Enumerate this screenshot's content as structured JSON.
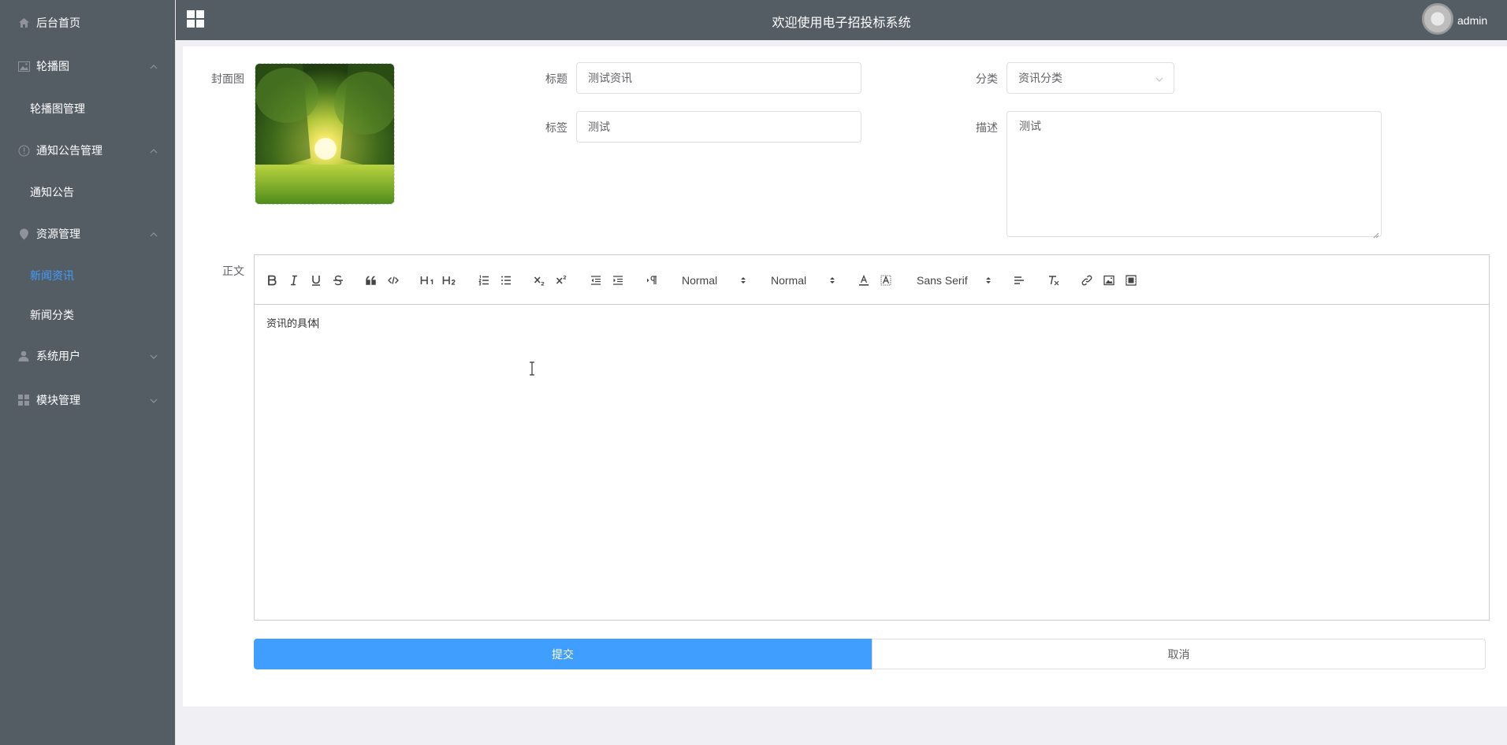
{
  "header": {
    "title": "欢迎使用电子招投标系统",
    "username": "admin"
  },
  "sidebar": {
    "items": [
      {
        "label": "后台首页",
        "icon": "home-icon"
      },
      {
        "label": "轮播图",
        "icon": "image-icon",
        "expanded": true,
        "children": [
          "轮播图管理"
        ]
      },
      {
        "label": "通知公告管理",
        "icon": "info-icon",
        "expanded": true,
        "children": [
          "通知公告"
        ]
      },
      {
        "label": "资源管理",
        "icon": "location-icon",
        "expanded": true,
        "children": [
          "新闻资讯",
          "新闻分类"
        ]
      },
      {
        "label": "系统用户",
        "icon": "user-icon",
        "expanded": false
      },
      {
        "label": "模块管理",
        "icon": "grid-icon",
        "expanded": false
      }
    ],
    "active_child": "新闻资讯"
  },
  "form": {
    "cover_label": "封面图",
    "title_label": "标题",
    "title_value": "测试资讯",
    "category_label": "分类",
    "category_value": "资讯分类",
    "tags_label": "标签",
    "tags_value": "测试",
    "description_label": "描述",
    "description_value": "测试",
    "body_label": "正文",
    "body_value": "资讯的具体"
  },
  "editor_toolbar": {
    "header_select": "Normal",
    "size_select": "Normal",
    "font_select": "Sans Serif",
    "buttons": [
      "bold-icon",
      "italic-icon",
      "underline-icon",
      "strike-icon",
      "blockquote-icon",
      "code-block-icon",
      "h1-icon",
      "h2-icon",
      "ordered-list-icon",
      "bullet-list-icon",
      "subscript-icon",
      "superscript-icon",
      "outdent-icon",
      "indent-icon",
      "rtl-icon",
      "text-color-icon",
      "background-color-icon",
      "align-icon",
      "clear-format-icon",
      "link-icon",
      "image-insert-icon",
      "video-insert-icon"
    ]
  },
  "actions": {
    "submit_label": "提交",
    "cancel_label": "取消"
  },
  "colors": {
    "sidebar_bg": "#545c64",
    "accent": "#409eff",
    "page_bg": "#f0f0f4"
  }
}
